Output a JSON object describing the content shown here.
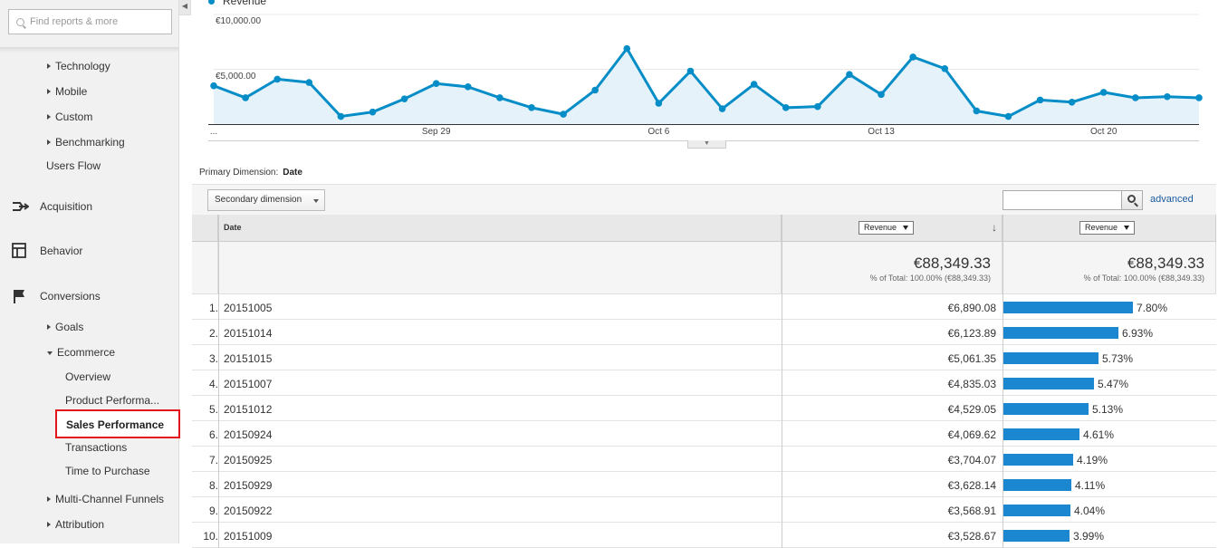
{
  "sidebar": {
    "search_placeholder": "Find reports & more",
    "collapse_glyph": "◀",
    "items_top": [
      "Technology",
      "Mobile",
      "Custom",
      "Benchmarking"
    ],
    "users_flow": "Users Flow",
    "sections": [
      "Acquisition",
      "Behavior",
      "Conversions"
    ],
    "goals": "Goals",
    "ecommerce": "Ecommerce",
    "ecommerce_items": [
      "Overview",
      "Product Performa...",
      "Sales Performance",
      "Transactions",
      "Time to Purchase"
    ],
    "items_bottom": [
      "Multi-Channel Funnels",
      "Attribution"
    ]
  },
  "chart_data": {
    "type": "area",
    "series": [
      {
        "name": "Revenue",
        "color": "#058dc7",
        "values": [
          3500,
          2400,
          4100,
          3800,
          700,
          1100,
          2300,
          3700,
          3400,
          2400,
          1500,
          900,
          3100,
          6890,
          1900,
          4835,
          1400,
          3628,
          1500,
          1600,
          4529,
          2700,
          6124,
          5061,
          1200,
          700,
          2200,
          2000,
          2900,
          2400,
          2500,
          2400
        ]
      }
    ],
    "y_ticks": [
      "€5,000.00",
      "€10,000.00"
    ],
    "ylim": [
      0,
      10000
    ],
    "x_ticks": [
      {
        "label": "...",
        "index": 0
      },
      {
        "label": "Sep 29",
        "index": 7
      },
      {
        "label": "Oct 6",
        "index": 14
      },
      {
        "label": "Oct 13",
        "index": 21
      },
      {
        "label": "Oct 20",
        "index": 28
      }
    ]
  },
  "chart_toggle_glyph": "▼",
  "primary_dimension": {
    "label": "Primary Dimension:",
    "value": "Date"
  },
  "secondary_dimension": "Secondary dimension",
  "advanced": "advanced",
  "table": {
    "col_date": "Date",
    "col_metric": "Revenue",
    "sort_glyph": "↓",
    "total_value": "€88,349.33",
    "total_pct": "% of Total: 100.00% (€88,349.33)",
    "rows": [
      {
        "idx": "1.",
        "date": "20151005",
        "value": "€6,890.08",
        "share": "7.80%",
        "frac": 0.078
      },
      {
        "idx": "2.",
        "date": "20151014",
        "value": "€6,123.89",
        "share": "6.93%",
        "frac": 0.0693
      },
      {
        "idx": "3.",
        "date": "20151015",
        "value": "€5,061.35",
        "share": "5.73%",
        "frac": 0.0573
      },
      {
        "idx": "4.",
        "date": "20151007",
        "value": "€4,835.03",
        "share": "5.47%",
        "frac": 0.0547
      },
      {
        "idx": "5.",
        "date": "20151012",
        "value": "€4,529.05",
        "share": "5.13%",
        "frac": 0.0513
      },
      {
        "idx": "6.",
        "date": "20150924",
        "value": "€4,069.62",
        "share": "4.61%",
        "frac": 0.0461
      },
      {
        "idx": "7.",
        "date": "20150925",
        "value": "€3,704.07",
        "share": "4.19%",
        "frac": 0.0419
      },
      {
        "idx": "8.",
        "date": "20150929",
        "value": "€3,628.14",
        "share": "4.11%",
        "frac": 0.0411
      },
      {
        "idx": "9.",
        "date": "20150922",
        "value": "€3,568.91",
        "share": "4.04%",
        "frac": 0.0404
      },
      {
        "idx": "10.",
        "date": "20151009",
        "value": "€3,528.67",
        "share": "3.99%",
        "frac": 0.0399
      }
    ]
  }
}
